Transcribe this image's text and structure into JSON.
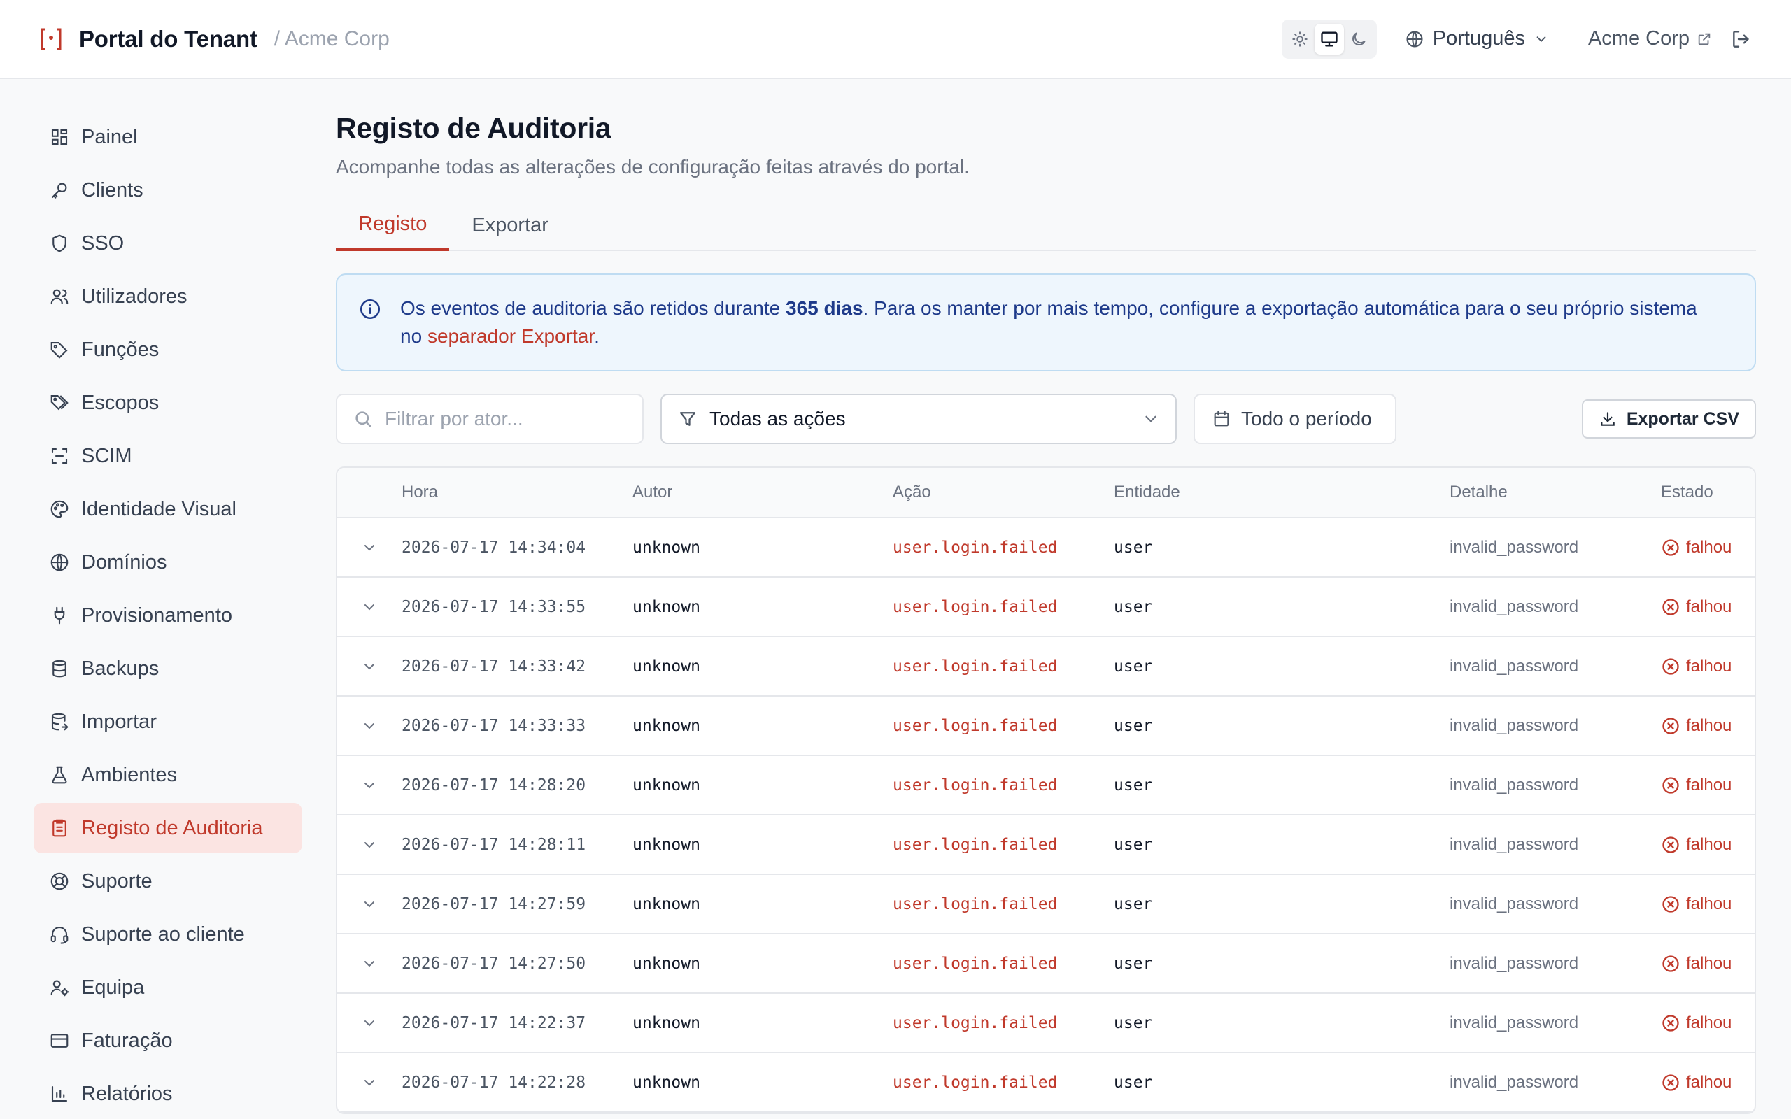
{
  "header": {
    "brand_title": "Portal do Tenant",
    "tenant_crumb": "/ Acme Corp",
    "theme_options": [
      "light-icon",
      "system-icon",
      "dark-icon"
    ],
    "theme_selected": "system",
    "language": "Português",
    "tenant_link": "Acme Corp"
  },
  "sidebar": {
    "items": [
      {
        "label": "Painel",
        "icon": "dashboard-icon"
      },
      {
        "label": "Clients",
        "icon": "key-icon"
      },
      {
        "label": "SSO",
        "icon": "shield-icon"
      },
      {
        "label": "Utilizadores",
        "icon": "users-icon"
      },
      {
        "label": "Funções",
        "icon": "tag-icon"
      },
      {
        "label": "Escopos",
        "icon": "tags-icon"
      },
      {
        "label": "SCIM",
        "icon": "scan-icon"
      },
      {
        "label": "Identidade Visual",
        "icon": "palette-icon"
      },
      {
        "label": "Domínios",
        "icon": "globe-icon"
      },
      {
        "label": "Provisionamento",
        "icon": "plug-icon"
      },
      {
        "label": "Backups",
        "icon": "database-icon"
      },
      {
        "label": "Importar",
        "icon": "database-import-icon"
      },
      {
        "label": "Ambientes",
        "icon": "flask-icon"
      },
      {
        "label": "Registo de Auditoria",
        "icon": "clipboard-icon"
      },
      {
        "label": "Suporte",
        "icon": "lifebuoy-icon"
      },
      {
        "label": "Suporte ao cliente",
        "icon": "headset-icon"
      },
      {
        "label": "Equipa",
        "icon": "user-gear-icon"
      },
      {
        "label": "Faturação",
        "icon": "credit-card-icon"
      },
      {
        "label": "Relatórios",
        "icon": "bar-chart-icon"
      }
    ],
    "active_index": 13
  },
  "main": {
    "title": "Registo de Auditoria",
    "subtitle": "Acompanhe todas as alterações de configuração feitas através do portal.",
    "tabs": [
      {
        "label": "Registo"
      },
      {
        "label": "Exportar"
      }
    ],
    "active_tab": 0,
    "info": {
      "prefix": "Os eventos de auditoria são retidos durante ",
      "bold": "365 dias",
      "middle": ". Para os manter por mais tempo, configure a exportação automática para o seu próprio sistema no ",
      "link": "separador Exportar",
      "suffix": "."
    },
    "filters": {
      "search_placeholder": "Filtrar por ator...",
      "action_select": "Todas as ações",
      "period": "Todo o período",
      "export_label": "Exportar CSV"
    },
    "table": {
      "columns": [
        "Hora",
        "Autor",
        "Ação",
        "Entidade",
        "Detalhe",
        "Estado"
      ],
      "rows": [
        {
          "time": "2026-07-17 14:34:04",
          "author": "unknown",
          "action": "user.login.failed",
          "entity": "user",
          "detail": "invalid_password",
          "status": "falhou"
        },
        {
          "time": "2026-07-17 14:33:55",
          "author": "unknown",
          "action": "user.login.failed",
          "entity": "user",
          "detail": "invalid_password",
          "status": "falhou"
        },
        {
          "time": "2026-07-17 14:33:42",
          "author": "unknown",
          "action": "user.login.failed",
          "entity": "user",
          "detail": "invalid_password",
          "status": "falhou"
        },
        {
          "time": "2026-07-17 14:33:33",
          "author": "unknown",
          "action": "user.login.failed",
          "entity": "user",
          "detail": "invalid_password",
          "status": "falhou"
        },
        {
          "time": "2026-07-17 14:28:20",
          "author": "unknown",
          "action": "user.login.failed",
          "entity": "user",
          "detail": "invalid_password",
          "status": "falhou"
        },
        {
          "time": "2026-07-17 14:28:11",
          "author": "unknown",
          "action": "user.login.failed",
          "entity": "user",
          "detail": "invalid_password",
          "status": "falhou"
        },
        {
          "time": "2026-07-17 14:27:59",
          "author": "unknown",
          "action": "user.login.failed",
          "entity": "user",
          "detail": "invalid_password",
          "status": "falhou"
        },
        {
          "time": "2026-07-17 14:27:50",
          "author": "unknown",
          "action": "user.login.failed",
          "entity": "user",
          "detail": "invalid_password",
          "status": "falhou"
        },
        {
          "time": "2026-07-17 14:22:37",
          "author": "unknown",
          "action": "user.login.failed",
          "entity": "user",
          "detail": "invalid_password",
          "status": "falhou"
        },
        {
          "time": "2026-07-17 14:22:28",
          "author": "unknown",
          "action": "user.login.failed",
          "entity": "user",
          "detail": "invalid_password",
          "status": "falhou"
        }
      ]
    }
  },
  "colors": {
    "accent": "#c0392b",
    "active_bg": "#fbe4e2",
    "info_bg": "#eef6fd",
    "info_text": "#1e3a8a"
  }
}
